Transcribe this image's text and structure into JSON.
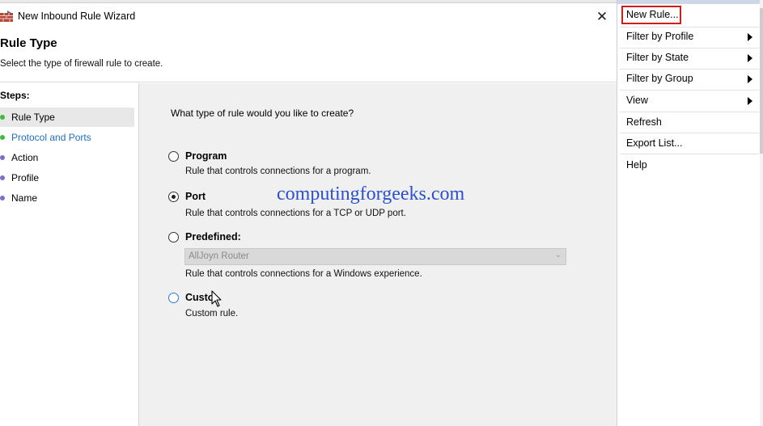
{
  "window": {
    "title": "New Inbound Rule Wizard",
    "header_title": "Rule Type",
    "header_subtitle": "Select the type of firewall rule to create."
  },
  "steps": {
    "title": "Steps:",
    "items": [
      {
        "label": "Rule Type",
        "state": "current",
        "dot_color": "#3fb93f",
        "text_color": "#000000"
      },
      {
        "label": "Protocol and Ports",
        "state": "next",
        "dot_color": "#3fb93f",
        "text_color": "#1c6fc6"
      },
      {
        "label": "Action",
        "state": "pending",
        "dot_color": "#7b6fc9",
        "text_color": "#000000"
      },
      {
        "label": "Profile",
        "state": "pending",
        "dot_color": "#7b6fc9",
        "text_color": "#000000"
      },
      {
        "label": "Name",
        "state": "pending",
        "dot_color": "#7b6fc9",
        "text_color": "#000000"
      }
    ]
  },
  "content": {
    "question": "What type of rule would you like to create?",
    "options": [
      {
        "label": "Program",
        "description": "Rule that controls connections for a program.",
        "checked": false
      },
      {
        "label": "Port",
        "description": "Rule that controls connections for a TCP or UDP port.",
        "checked": true
      },
      {
        "label": "Predefined:",
        "description": "Rule that controls connections for a Windows experience.",
        "checked": false
      },
      {
        "label": "Custo",
        "description": "Custom rule.",
        "checked": false
      }
    ],
    "predefined_select": {
      "value": "AllJoyn Router",
      "disabled": true
    }
  },
  "watermark": "computingforgeeks.com",
  "actions": {
    "items": [
      {
        "label": "New Rule...",
        "submenu": false,
        "highlighted": true
      },
      {
        "label": "Filter by Profile",
        "submenu": true
      },
      {
        "label": "Filter by State",
        "submenu": true
      },
      {
        "label": "Filter by Group",
        "submenu": true
      },
      {
        "label": "View",
        "submenu": true
      },
      {
        "label": "Refresh",
        "submenu": false
      },
      {
        "label": "Export List...",
        "submenu": false
      },
      {
        "label": "Help",
        "submenu": false
      }
    ]
  },
  "colors": {
    "highlight_box": "#d01d1d",
    "watermark": "#2a4fd0",
    "link_step": "#1c6fc6"
  },
  "icons": {
    "app": "firewall-brick-icon",
    "close": "close-icon",
    "submenu": "chevron-right-icon"
  }
}
